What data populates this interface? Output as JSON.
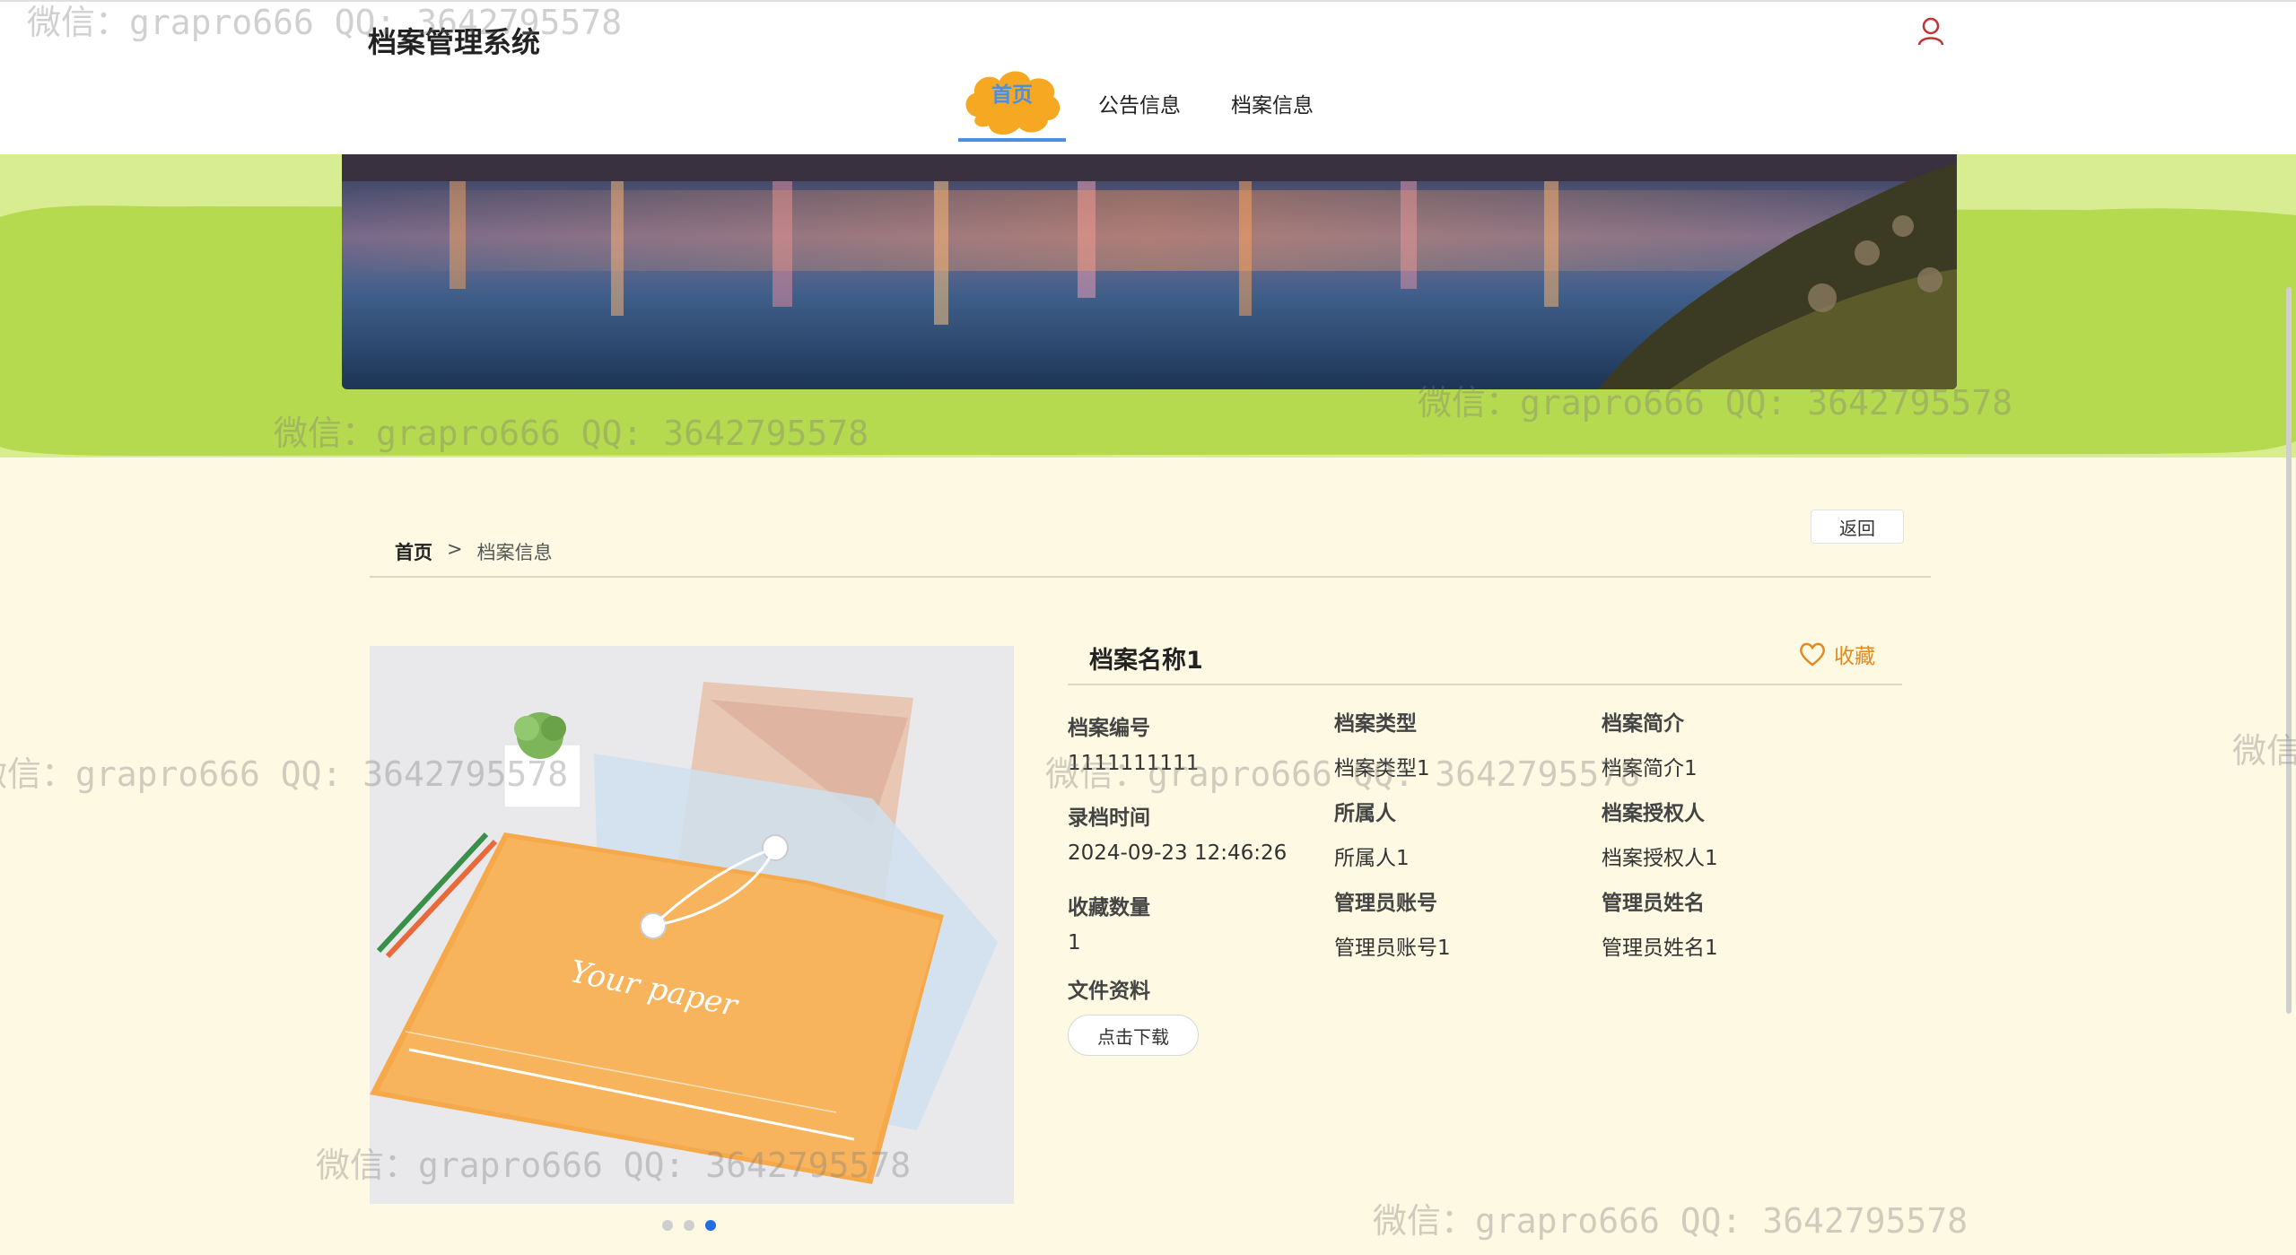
{
  "header": {
    "site_title": "档案管理系统",
    "nav": [
      {
        "label": "首页",
        "active": true
      },
      {
        "label": "公告信息",
        "active": false
      },
      {
        "label": "档案信息",
        "active": false
      }
    ],
    "user_icon": "user-icon"
  },
  "breadcrumb": {
    "home": "首页",
    "separator": ">",
    "current": "档案信息",
    "back_label": "返回"
  },
  "product": {
    "image_text": "Your paper",
    "carousel_count": 3,
    "carousel_active": 3
  },
  "detail": {
    "title": "档案名称1",
    "favorite_label": "收藏",
    "fields": [
      {
        "label": "档案编号",
        "value": "1111111111"
      },
      {
        "label": "档案类型",
        "value": "档案类型1"
      },
      {
        "label": "档案简介",
        "value": "档案简介1"
      },
      {
        "label": "录档时间",
        "value": "2024-09-23 12:46:26"
      },
      {
        "label": "所属人",
        "value": "所属人1"
      },
      {
        "label": "档案授权人",
        "value": "档案授权人1"
      },
      {
        "label": "收藏数量",
        "value": "1"
      },
      {
        "label": "管理员账号",
        "value": "管理员账号1"
      },
      {
        "label": "管理员姓名",
        "value": "管理员姓名1"
      }
    ],
    "file_label": "文件资料",
    "download_label": "点击下载"
  },
  "watermark": "微信：grapro666 QQ: 3642795578",
  "colors": {
    "accent": "#4a8fe0",
    "cloud": "#f7a823",
    "green": "#b5d94f",
    "bg": "#fdf9e3",
    "favorite": "#e08a1f"
  }
}
